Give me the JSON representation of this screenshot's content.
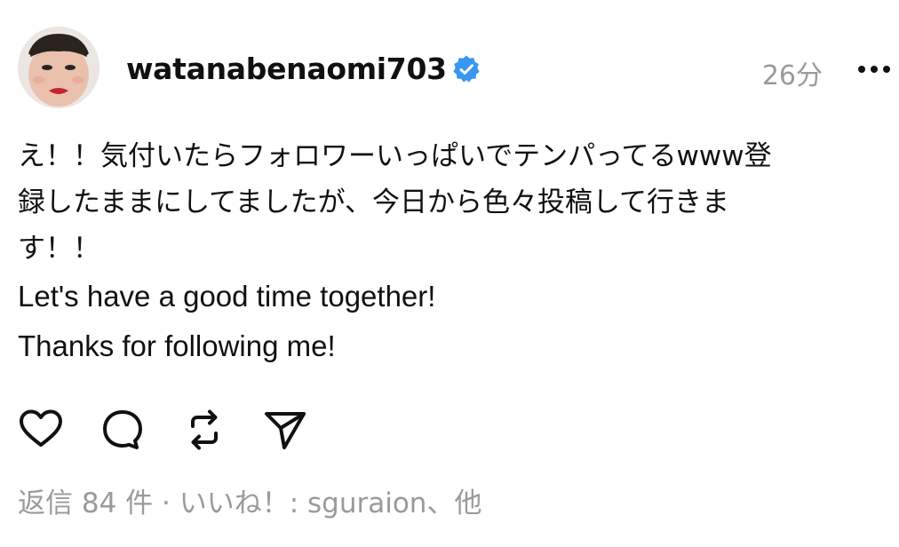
{
  "post": {
    "username": "watanabenaomi703",
    "time": "26分",
    "caption": {
      "line1": "え！！気付いたらフォロワーいっぱいでテンパってるwww登",
      "line2": "録したままにしてましたが、今日から色々投稿して行きま",
      "line3": "す！！",
      "line4": "Let's have a good time together!",
      "line5": "Thanks for following me!"
    },
    "stats": "返信 84 件 · いいね！: sguraion、他"
  },
  "icons": {
    "verified": "verified-badge-icon",
    "more": "more-options-icon",
    "like": "heart-icon",
    "reply": "comment-icon",
    "repost": "repost-icon",
    "share": "send-icon"
  },
  "colors": {
    "verified_blue": "#3897f0",
    "muted": "#9a9a9a",
    "text": "#111111"
  }
}
